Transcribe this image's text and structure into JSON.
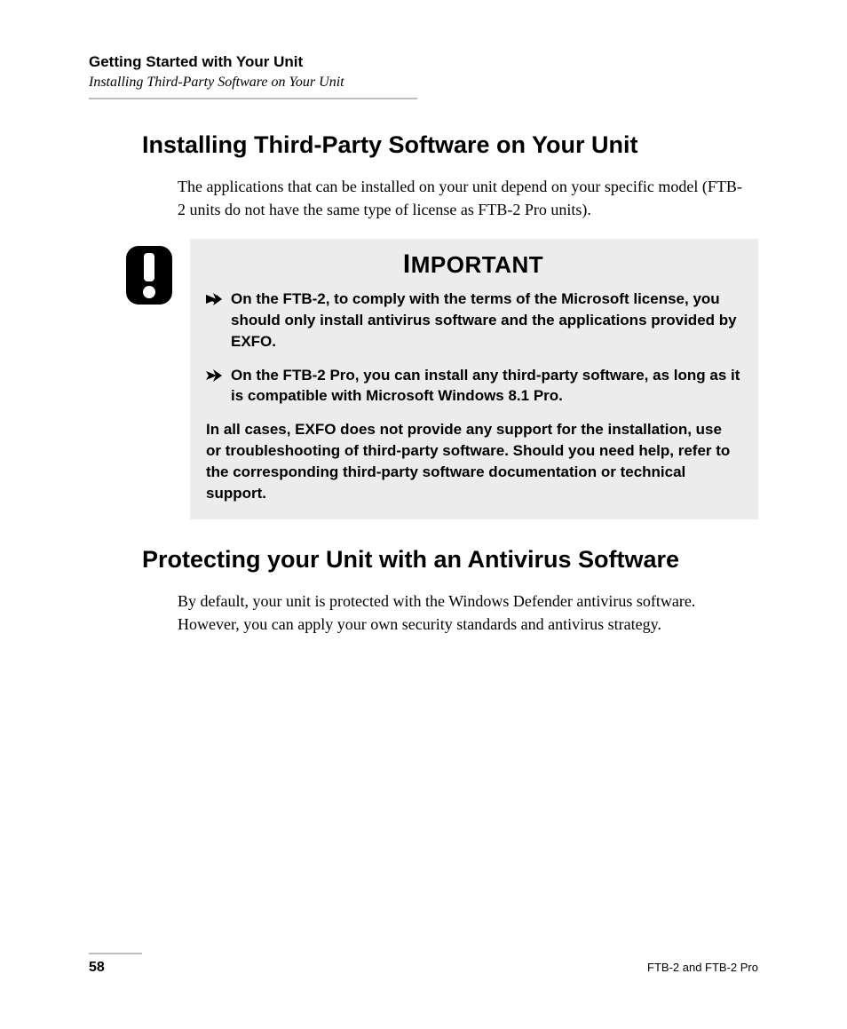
{
  "header": {
    "running_title": "Getting Started with Your Unit",
    "running_subtitle": "Installing Third-Party Software on Your Unit"
  },
  "section1": {
    "heading": "Installing Third-Party Software on Your Unit",
    "paragraph": "The applications that can be installed on your unit depend on your specific model (FTB-2 units do not have the same type of license as FTB-2 Pro units)."
  },
  "callout": {
    "title_first_letter": "I",
    "title_rest": "MPORTANT",
    "items": [
      "On the FTB-2, to comply with the terms of the Microsoft license, you should only install antivirus software and the applications provided by EXFO.",
      "On the FTB-2 Pro, you can install any third-party software, as long as it is compatible with Microsoft Windows 8.1 Pro."
    ],
    "footer": "In all cases, EXFO does not provide any support for the installation, use or troubleshooting of third-party software. Should you need help, refer to the corresponding third-party software documentation or technical support."
  },
  "section2": {
    "heading": "Protecting your Unit with an Antivirus Software",
    "paragraph": "By default, your unit is protected with the Windows Defender antivirus software. However, you can apply your own security standards and antivirus strategy."
  },
  "footer": {
    "page_number": "58",
    "doc_id": "FTB-2 and FTB-2 Pro"
  }
}
